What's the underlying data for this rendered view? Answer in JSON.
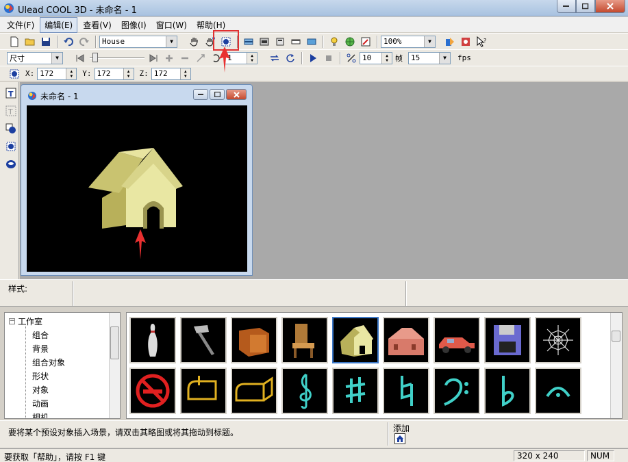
{
  "window": {
    "title": "Ulead COOL 3D - 未命名 - 1"
  },
  "menu": [
    "文件(F)",
    "编辑(E)",
    "查看(V)",
    "图像(I)",
    "窗口(W)",
    "帮助(H)"
  ],
  "toolbar": {
    "object_combo": "House",
    "zoom_combo": "100%"
  },
  "toolbar2": {
    "mode_combo": "尺寸",
    "frame_spin": "1",
    "frames_spin": "10",
    "frames_label": "帧",
    "fps_combo": "15",
    "fps_label": "fps"
  },
  "toolbar3": {
    "x_label": "X:",
    "x_value": "172",
    "y_label": "Y:",
    "y_value": "172",
    "z_label": "Z:",
    "z_value": "172"
  },
  "child_window": {
    "title": "未命名 - 1"
  },
  "style_bar": {
    "label": "样式:"
  },
  "tree": {
    "root": "工作室",
    "items": [
      "组合",
      "背景",
      "组合对象",
      "形状",
      "对象",
      "动画",
      "相机"
    ]
  },
  "gallery": {
    "thumbnails": [
      "bowling-pin",
      "hammer",
      "box",
      "chair",
      "house",
      "barn",
      "car",
      "floppy-disk",
      "spider-web",
      "no-smoking",
      "mailbox",
      "mailbox-open",
      "treble-clef",
      "sharp",
      "natural",
      "bass-clef",
      "flat",
      "fermata"
    ]
  },
  "hint": {
    "text": "要将某个预设对象插入场景，请双击其略图或将其拖动到标题。",
    "add_label": "添加"
  },
  "status": {
    "help_text": "要获取「帮助」，请按 F1 键",
    "size": "320 x 240",
    "num": "NUM"
  }
}
